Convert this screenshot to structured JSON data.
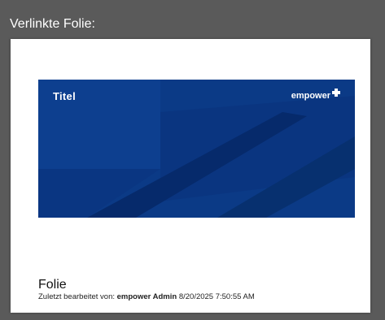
{
  "panel": {
    "title": "Verlinkte Folie:"
  },
  "slide": {
    "title": "Titel",
    "brand_name": "empower",
    "background_color": "#0b3a86"
  },
  "document": {
    "name": "Folie",
    "edited_prefix": "Zuletzt bearbeitet von: ",
    "editor": "empower Admin",
    "timestamp": "8/20/2025 7:50:55 AM"
  }
}
